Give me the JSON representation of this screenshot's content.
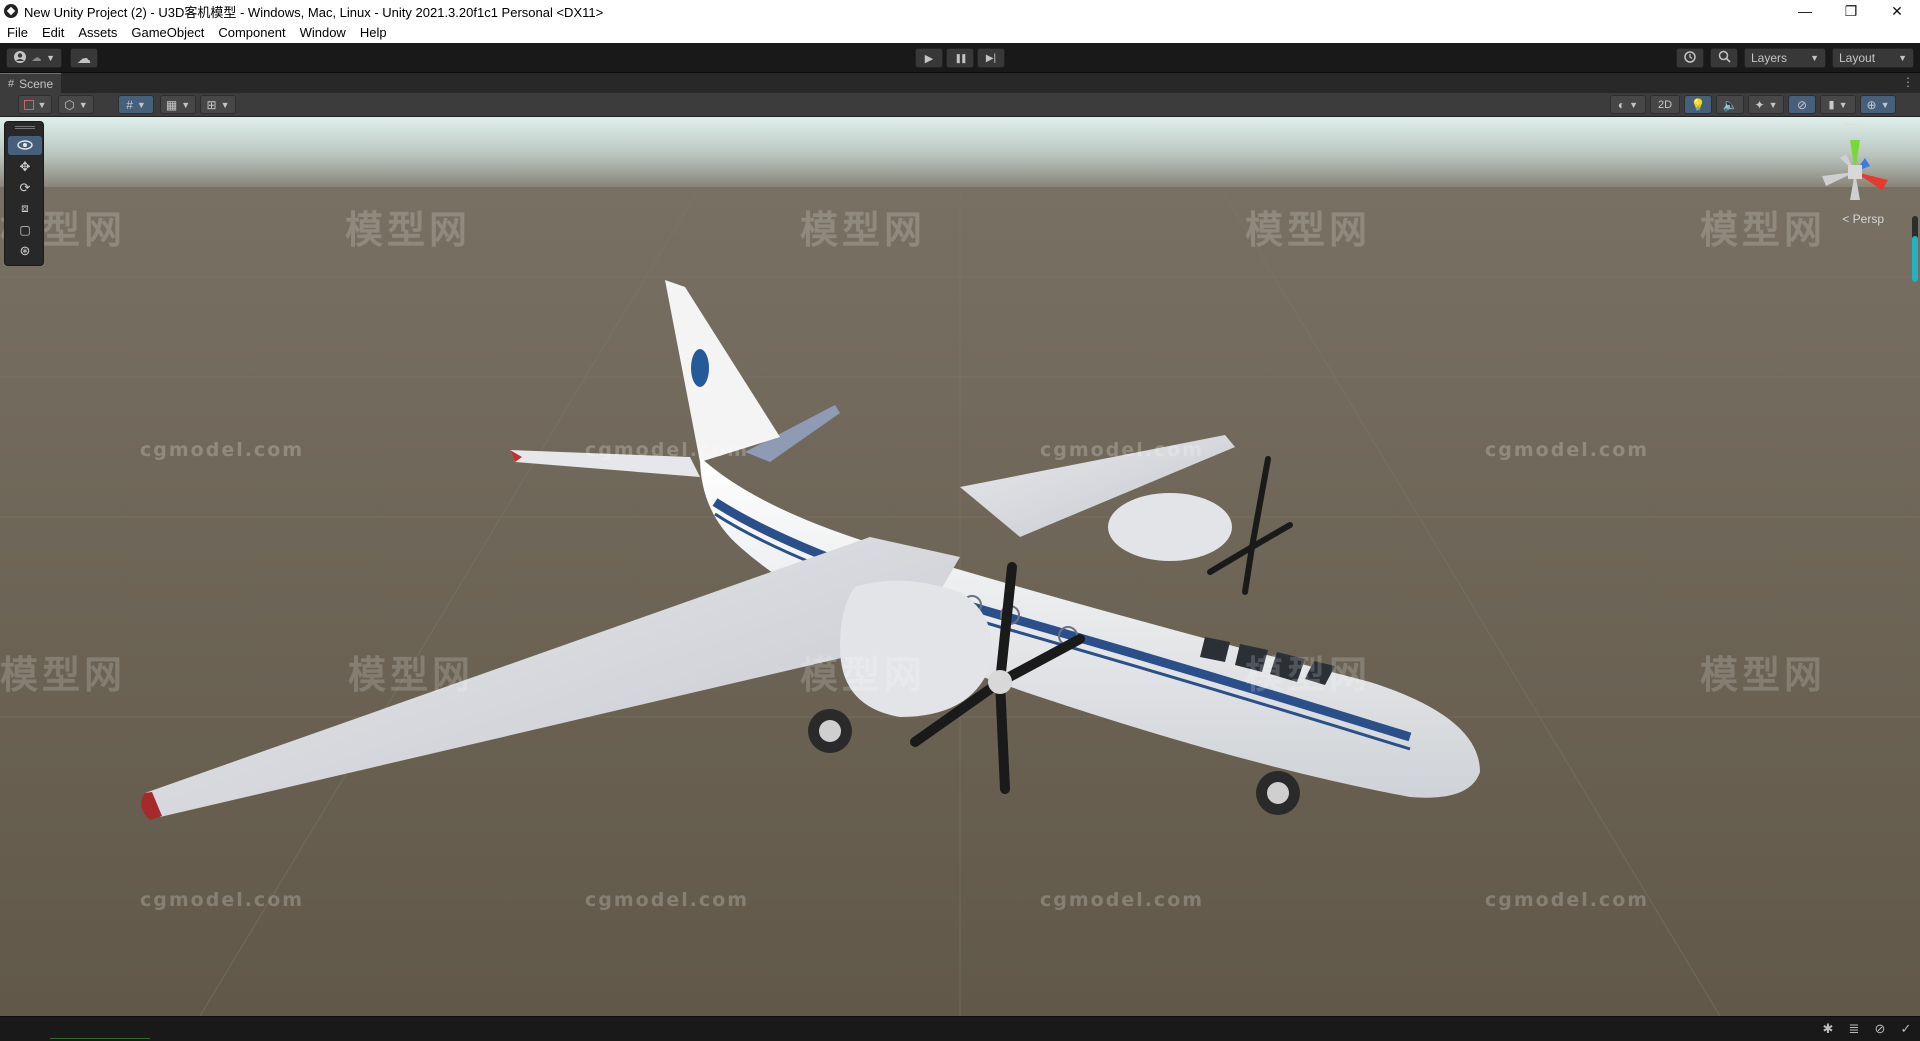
{
  "window": {
    "title": "New Unity Project (2) - U3D客机模型 - Windows, Mac, Linux - Unity 2021.3.20f1c1 Personal <DX11>",
    "controls": {
      "minimize": "—",
      "restore": "❐",
      "close": "✕"
    }
  },
  "menubar": {
    "items": [
      "File",
      "Edit",
      "Assets",
      "GameObject",
      "Component",
      "Window",
      "Help"
    ]
  },
  "toolbar": {
    "account_icon": "account-icon",
    "cloud_icon": "cloud-icon",
    "play_icon": "▶",
    "pause_icon": "❚❚",
    "step_icon": "▶|",
    "history_icon": "history-icon",
    "search_icon": "search-icon",
    "layers_label": "Layers",
    "layout_label": "Layout"
  },
  "tab": {
    "label": "Scene",
    "icon": "grid-icon"
  },
  "scene_toolbar": {
    "toggle_2d": "2D",
    "colors": {
      "active": "#46607c",
      "bg": "#3c3c3c"
    }
  },
  "tools": [
    "view-tool",
    "move-tool",
    "rotate-tool",
    "scale-tool",
    "rect-tool",
    "transform-tool"
  ],
  "viewport": {
    "persp_label": "< Persp",
    "watermark_text": "cgmodel.com",
    "watermark_logo": "模型网",
    "colors": {
      "ground": "#6b6254",
      "sky_top": "#d7ece8",
      "fuselage": "#f2f2f2",
      "stripe": "#2a4f8a"
    }
  }
}
